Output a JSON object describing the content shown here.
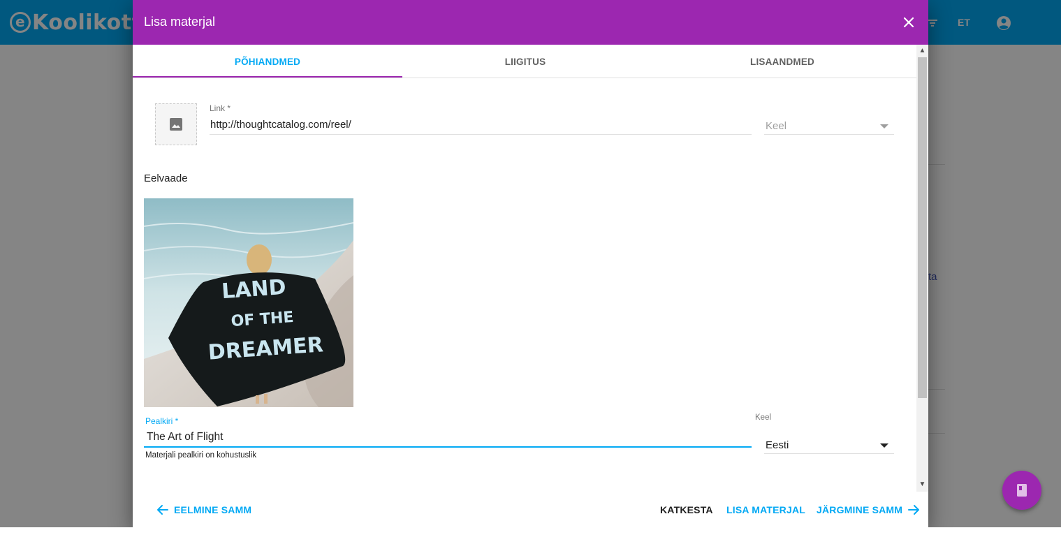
{
  "app": {
    "logo_text": "Koolikott",
    "logo_prefix": "e",
    "header_language": "ET",
    "bg_link_fragment": "ta"
  },
  "dialog": {
    "title": "Lisa materjal",
    "tabs": [
      {
        "label": "PÕHIANDMED",
        "active": true
      },
      {
        "label": "LIIGITUS",
        "active": false
      },
      {
        "label": "LISAANDMED",
        "active": false
      }
    ],
    "link_field": {
      "label": "Link *",
      "value": "http://thoughtcatalog.com/reel/"
    },
    "link_language": {
      "placeholder": "Keel"
    },
    "preview": {
      "heading": "Eelvaade",
      "image_text_lines": [
        "LAND",
        "OF THE",
        "DREAMER"
      ]
    },
    "title_field": {
      "label": "Pealkiri *",
      "value": "The Art of Flight",
      "hint": "Materjali pealkiri on kohustuslik"
    },
    "title_language": {
      "label": "Keel",
      "value": "Eesti"
    },
    "actions": {
      "previous": "EELMINE SAMM",
      "cancel": "KATKESTA",
      "add": "LISA MATERJAL",
      "next": "JÄRGMINE SAMM"
    }
  },
  "colors": {
    "header_blue": "#03a9f4",
    "dialog_purple": "#9c27b0",
    "accent": "#03a9f4"
  },
  "icons": {
    "close": "close-icon",
    "image_placeholder": "image-icon",
    "account": "account-circle-icon",
    "fab": "book-icon",
    "back": "arrow-left-icon",
    "forward": "arrow-right-icon"
  }
}
